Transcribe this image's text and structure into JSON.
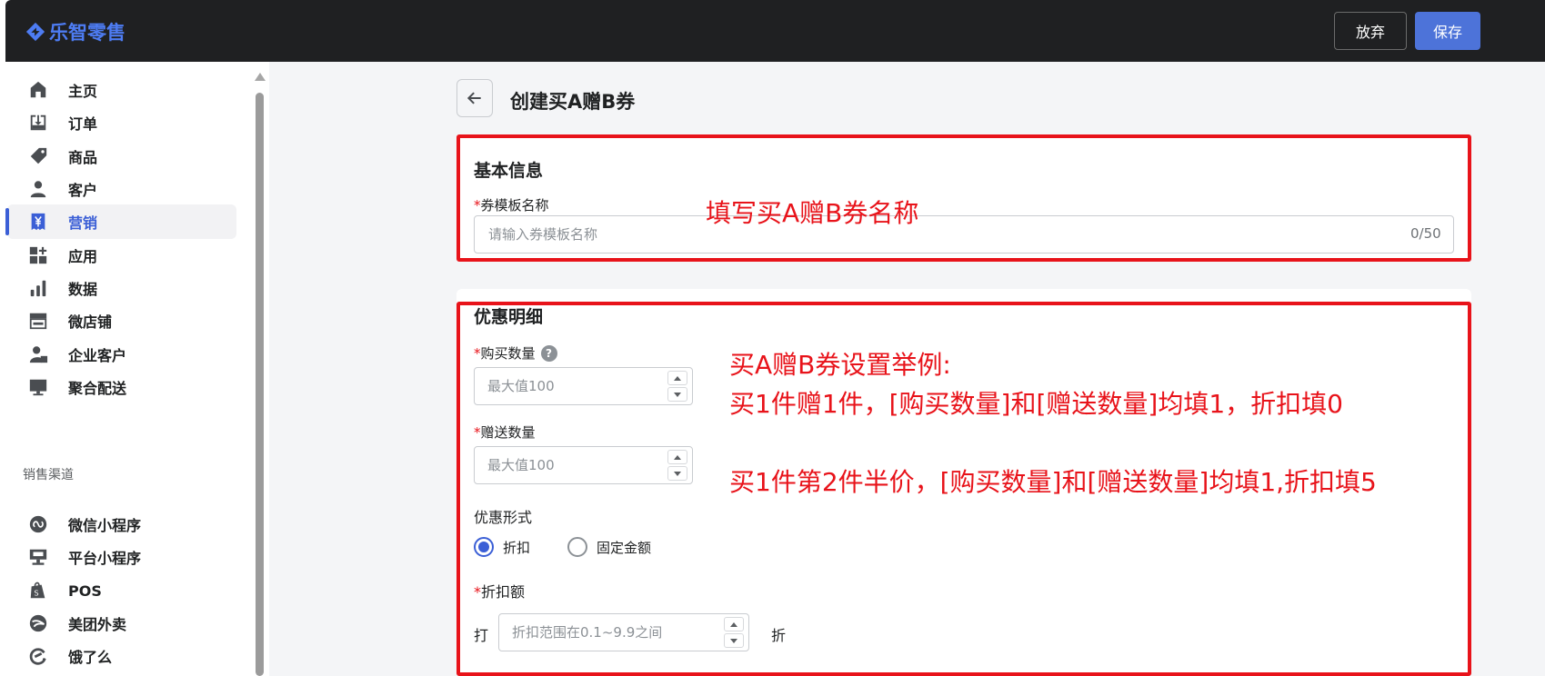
{
  "app": {
    "logo_text": "乐智零售",
    "brand_color": "#4d7cf3"
  },
  "header": {
    "discard_label": "放弃",
    "save_label": "保存"
  },
  "sidebar": {
    "items": [
      {
        "label": "主页",
        "icon": "home-icon"
      },
      {
        "label": "订单",
        "icon": "orders-icon"
      },
      {
        "label": "商品",
        "icon": "tag-icon"
      },
      {
        "label": "客户",
        "icon": "person-icon"
      },
      {
        "label": "营销",
        "icon": "yen-receipt-icon",
        "active": true
      },
      {
        "label": "应用",
        "icon": "apps-icon"
      },
      {
        "label": "数据",
        "icon": "bar-chart-icon"
      },
      {
        "label": "微店铺",
        "icon": "store-icon"
      },
      {
        "label": "企业客户",
        "icon": "enterprise-user-icon"
      },
      {
        "label": "聚合配送",
        "icon": "monitor-icon"
      }
    ],
    "channels_heading": "销售渠道",
    "channels": [
      {
        "label": "微信小程序",
        "icon": "mini-program-icon"
      },
      {
        "label": "平台小程序",
        "icon": "platform-icon"
      },
      {
        "label": "POS",
        "icon": "pos-bag-icon"
      },
      {
        "label": "美团外卖",
        "icon": "meituan-icon"
      },
      {
        "label": "饿了么",
        "icon": "eleme-icon"
      }
    ],
    "active_color": "#3b5fd6"
  },
  "page": {
    "title": "创建买A赠B券"
  },
  "basic_info": {
    "title": "基本信息",
    "name_label": "券模板名称",
    "name_placeholder": "请输入券模板名称",
    "name_counter": "0/50"
  },
  "discount_detail": {
    "title": "优惠明细",
    "buy_qty_label": "购买数量",
    "buy_qty_placeholder": "最大值100",
    "gift_qty_label": "赠送数量",
    "gift_qty_placeholder": "最大值100",
    "form_label": "优惠形式",
    "form_options": [
      {
        "label": "折扣",
        "checked": true
      },
      {
        "label": "固定金额",
        "checked": false
      }
    ],
    "discount_label": "折扣额",
    "discount_prefix": "打",
    "discount_placeholder": "折扣范围在0.1~9.9之间",
    "discount_suffix": "折"
  },
  "annotations": {
    "name_hint": "填写买A赠B券名称",
    "example_title": "买A赠B券设置举例:",
    "example_1": "买1件赠1件，[购买数量]和[赠送数量]均填1，折扣填0",
    "example_2": "买1件第2件半价，[购买数量]和[赠送数量]均填1,折扣填5",
    "color": "#e8131a"
  }
}
